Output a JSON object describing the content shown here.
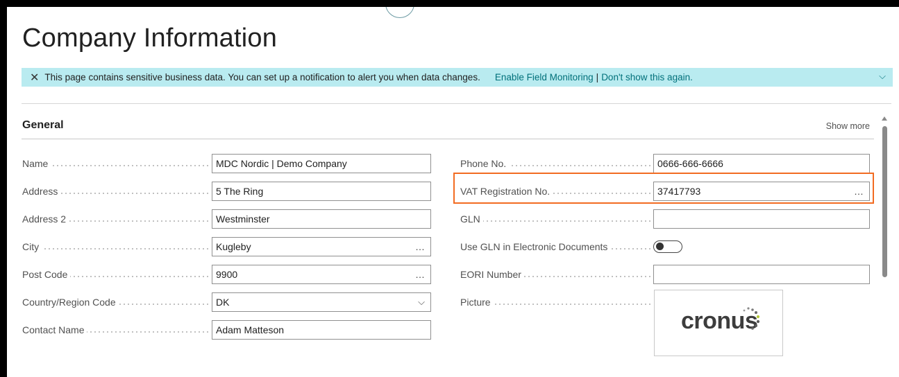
{
  "page": {
    "title": "Company Information"
  },
  "notification": {
    "message": "This page contains sensitive business data. You can set up a notification to alert you when data changes.",
    "enable_link": "Enable Field Monitoring",
    "separator": "|",
    "dismiss_link": "Don't show this again.",
    "close_icon": "close-icon",
    "expand_icon": "chevron-down-icon"
  },
  "section": {
    "title": "General",
    "show_more": "Show more"
  },
  "left_fields": [
    {
      "label": "Name",
      "value": "MDC Nordic | Demo Company"
    },
    {
      "label": "Address",
      "value": "5 The Ring"
    },
    {
      "label": "Address 2",
      "value": "Westminster"
    },
    {
      "label": "City",
      "value": "Kugleby",
      "action": "…"
    },
    {
      "label": "Post Code",
      "value": "9900",
      "action": "…"
    },
    {
      "label": "Country/Region Code",
      "value": "DK",
      "action": "⌵"
    },
    {
      "label": "Contact Name",
      "value": "Adam Matteson"
    }
  ],
  "right_fields": [
    {
      "label": "Phone No.",
      "value": "0666-666-6666"
    },
    {
      "label": "VAT Registration No.",
      "value": "37417793",
      "action": "…"
    },
    {
      "label": "GLN",
      "value": ""
    },
    {
      "label": "Use GLN in Electronic Documents",
      "toggle": false
    },
    {
      "label": "EORI Number",
      "value": ""
    },
    {
      "label": "Picture"
    }
  ],
  "picture": {
    "logo_text": "cronus"
  },
  "colors": {
    "notification_bg": "#b9ebf0",
    "link": "#00707a",
    "highlight": "#f26b21"
  }
}
